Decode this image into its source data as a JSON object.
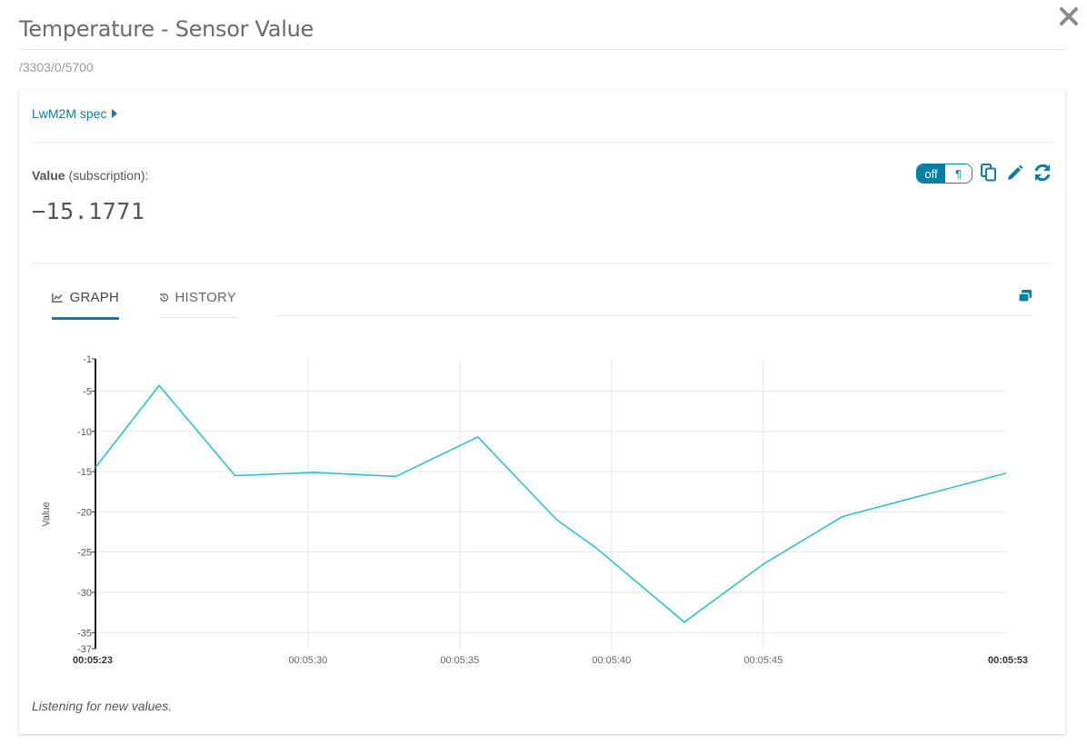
{
  "header": {
    "title": "Temperature - Sensor Value",
    "path": "/3303/0/5700"
  },
  "card": {
    "spec_link": "LwM2M spec",
    "value_label_bold": "Value",
    "value_label_rest": " (subscription):",
    "value": "−15.1771",
    "toggle_off": "off",
    "toggle_para": "¶"
  },
  "tabs": [
    {
      "label": "GRAPH",
      "active": true
    },
    {
      "label": "HISTORY",
      "active": false
    }
  ],
  "status": "Listening for new values.",
  "colors": {
    "accent": "#0a7fa6",
    "series": "#1ec0d6",
    "grid": "#e6e6e6"
  },
  "chart_data": {
    "type": "line",
    "ylabel": "Value",
    "ylim": [
      -37,
      -1
    ],
    "yticks": [
      "-1",
      "-5",
      "-10",
      "-15",
      "-20",
      "-25",
      "-30",
      "-35",
      "-37"
    ],
    "ytick_values": [
      -1,
      -5,
      -10,
      -15,
      -20,
      -25,
      -30,
      -35,
      -37
    ],
    "xlim_seconds": [
      323,
      353
    ],
    "xticks": [
      {
        "t": 323,
        "label": "00:05:23",
        "bold": true
      },
      {
        "t": 330,
        "label": "00:05:30",
        "bold": false
      },
      {
        "t": 335,
        "label": "00:05:35",
        "bold": false
      },
      {
        "t": 340,
        "label": "00:05:40",
        "bold": false
      },
      {
        "t": 345,
        "label": "00:05:45",
        "bold": false
      },
      {
        "t": 353,
        "label": "00:05:53",
        "bold": true
      }
    ],
    "series": [
      {
        "x": [
          "00:05:23",
          "00:05:25.1",
          "00:05:27.6",
          "00:05:30.2",
          "00:05:32.9",
          "00:05:35.6",
          "00:05:38.2",
          "00:05:40.8",
          "00:05:43.4",
          "00:05:46.0",
          "00:05:48.6",
          "00:05:53"
        ],
        "x_seconds": [
          323.0,
          325.1,
          327.6,
          330.2,
          332.9,
          335.6,
          338.2,
          339.5,
          342.4,
          345.0,
          347.6,
          353.0
        ],
        "values": [
          -14.5,
          -4.3,
          -15.5,
          -15.1,
          -15.6,
          -10.7,
          -21.0,
          -24.5,
          -33.7,
          -26.5,
          -20.6,
          -15.2
        ]
      }
    ]
  }
}
